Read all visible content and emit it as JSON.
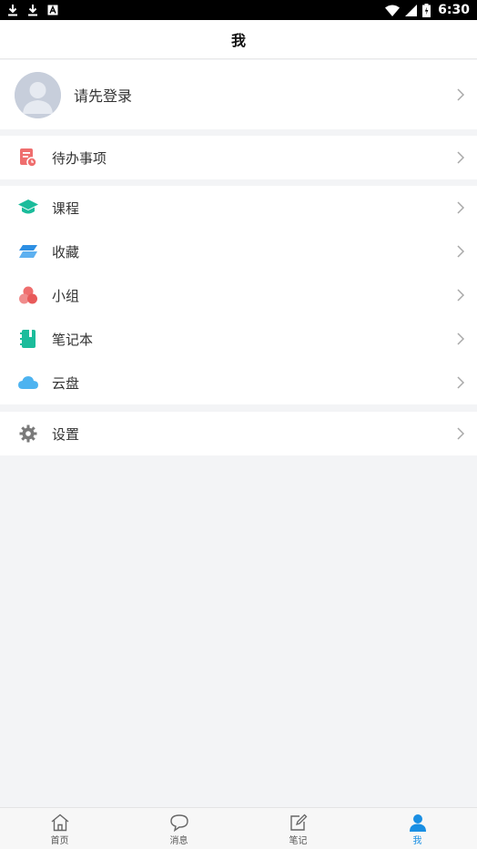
{
  "status_bar": {
    "time": "6:30"
  },
  "header": {
    "title": "我"
  },
  "profile": {
    "login_prompt": "请先登录"
  },
  "todo": {
    "label": "待办事项"
  },
  "menu": {
    "items": [
      {
        "label": "课程",
        "icon": "graduation-cap-icon"
      },
      {
        "label": "收藏",
        "icon": "bookmark-layers-icon"
      },
      {
        "label": "小组",
        "icon": "group-circles-icon"
      },
      {
        "label": "笔记本",
        "icon": "notebook-icon"
      },
      {
        "label": "云盘",
        "icon": "cloud-icon"
      }
    ]
  },
  "settings": {
    "label": "设置"
  },
  "bottom_nav": {
    "tabs": [
      {
        "label": "首页",
        "icon": "home-icon"
      },
      {
        "label": "消息",
        "icon": "message-bubble-icon"
      },
      {
        "label": "笔记",
        "icon": "note-edit-icon"
      },
      {
        "label": "我",
        "icon": "person-icon",
        "active": true
      }
    ]
  },
  "colors": {
    "accent": "#1a8fe3",
    "background": "#f3f4f6",
    "todo_icon": "#ef6e6e",
    "course_icon": "#1bbc9b",
    "favorite_icon": "#2d8fe3",
    "group_icon": "#ef6e6e",
    "notebook_icon": "#1bbc9b",
    "cloud_icon": "#4db3f0",
    "settings_icon": "#7a7a7a"
  }
}
